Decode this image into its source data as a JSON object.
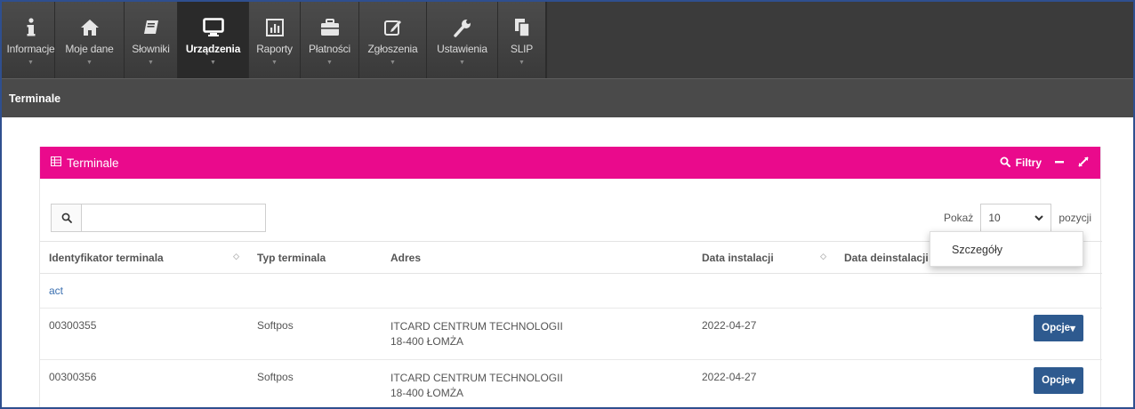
{
  "nav": {
    "items": [
      {
        "label": "Informacje",
        "icon": "info-icon"
      },
      {
        "label": "Moje dane",
        "icon": "home-icon"
      },
      {
        "label": "Słowniki",
        "icon": "book-icon"
      },
      {
        "label": "Urządzenia",
        "icon": "monitor-icon",
        "active": true
      },
      {
        "label": "Raporty",
        "icon": "bar-chart-icon"
      },
      {
        "label": "Płatności",
        "icon": "briefcase-icon"
      },
      {
        "label": "Zgłoszenia",
        "icon": "edit-icon"
      },
      {
        "label": "Ustawienia",
        "icon": "wrench-icon"
      },
      {
        "label": "SLIP",
        "icon": "documents-icon"
      }
    ]
  },
  "breadcrumb": "Terminale",
  "panel": {
    "title": "Terminale",
    "filters_label": "Filtry",
    "accent_color": "#ea0a8c"
  },
  "search": {
    "value": "",
    "placeholder": ""
  },
  "pager": {
    "show_label": "Pokaż",
    "page_size": "10",
    "suffix_label": "pozycji"
  },
  "table": {
    "headers": [
      "Identyfikator terminala",
      "Typ terminala",
      "Adres",
      "Data instalacji",
      "Data deinstalacji"
    ],
    "group_label": "act",
    "rows": [
      {
        "id": "00300355",
        "type": "Softpos",
        "address_line1": "ITCARD CENTRUM TECHNOLOGII",
        "address_line2": "18-400 ŁOMŻA",
        "install_date": "2022-04-27",
        "uninstall_date": ""
      },
      {
        "id": "00300356",
        "type": "Softpos",
        "address_line1": "ITCARD CENTRUM TECHNOLOGII",
        "address_line2": "18-400 ŁOMŻA",
        "install_date": "2022-04-27",
        "uninstall_date": ""
      }
    ],
    "options_label": "Opcje",
    "options_color": "#2e5a8f"
  },
  "dropdown": {
    "items": [
      "Szczegóły"
    ]
  }
}
